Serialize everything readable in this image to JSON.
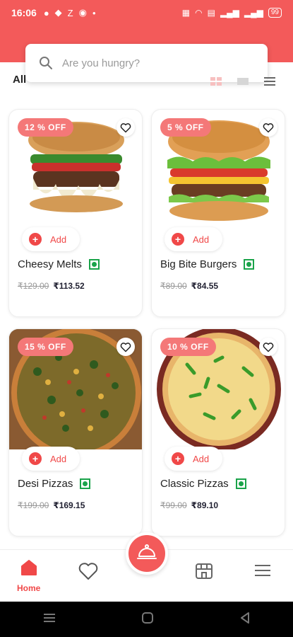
{
  "status_bar": {
    "time": "16:06",
    "battery": "99"
  },
  "search": {
    "placeholder": "Are you hungry?"
  },
  "filter": {
    "label": "All"
  },
  "items": [
    {
      "discount": "12 % OFF",
      "add_label": "Add",
      "name": "Cheesy Melts",
      "old_price": "₹129.00",
      "new_price": "₹113.52"
    },
    {
      "discount": "5 % OFF",
      "add_label": "Add",
      "name": "Big Bite Burgers",
      "old_price": "₹89.00",
      "new_price": "₹84.55"
    },
    {
      "discount": "15 % OFF",
      "add_label": "Add",
      "name": "Desi Pizzas",
      "old_price": "₹199.00",
      "new_price": "₹169.15"
    },
    {
      "discount": "10 % OFF",
      "add_label": "Add",
      "name": "Classic Pizzas",
      "old_price": "₹99.00",
      "new_price": "₹89.10"
    }
  ],
  "bottom_nav": {
    "home_label": "Home"
  },
  "colors": {
    "brand": "#f35a5a",
    "accent": "#f04848",
    "veg": "#1aa34a"
  },
  "icons": {
    "search": "search-icon",
    "favorite": "heart-outline-icon",
    "add": "plus-circle-icon",
    "veg": "veg-mark-icon",
    "home": "home-icon",
    "wishlist": "heart-icon",
    "cart": "cloche-icon",
    "store": "store-icon",
    "menu": "hamburger-menu-icon"
  }
}
